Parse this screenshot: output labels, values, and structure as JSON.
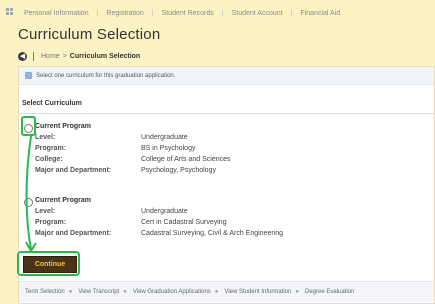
{
  "top_nav": {
    "items": [
      "Personal Information",
      "Registration",
      "Student Records",
      "Student Account",
      "Financial Aid"
    ]
  },
  "page": {
    "title": "Curriculum Selection",
    "breadcrumb": {
      "home": "Home",
      "separator": ">",
      "current": "Curriculum Selection"
    }
  },
  "info_message": "Select one curriculum for this graduation application.",
  "section_title": "Select Curriculum",
  "options": [
    {
      "title": "Current Program",
      "selected": false,
      "rows": [
        {
          "label": "Level:",
          "value": "Undergraduate"
        },
        {
          "label": "Program:",
          "value": "BS in Psychology"
        },
        {
          "label": "College:",
          "value": "College of Arts and Sciences"
        },
        {
          "label": "Major and Department:",
          "value": "Psychology, Psychology"
        }
      ]
    },
    {
      "title": "Current Program",
      "selected": false,
      "rows": [
        {
          "label": "Level:",
          "value": "Undergraduate"
        },
        {
          "label": "Program:",
          "value": "Cert in Cadastral Surveying"
        },
        {
          "label": "Major and Department:",
          "value": "Cadastral Surveying, Civil & Arch Engineering"
        }
      ]
    }
  ],
  "continue_label": "Continue",
  "bottom_links": [
    "Term Selection",
    "View Transcript",
    "View Graduation Applications",
    "View Student Information",
    "Degree Evaluation"
  ],
  "colors": {
    "page_bg": "#fcf3c5",
    "highlight": "#2bb84a",
    "continue_bg": "#4a3319",
    "continue_text": "#f0c040"
  }
}
